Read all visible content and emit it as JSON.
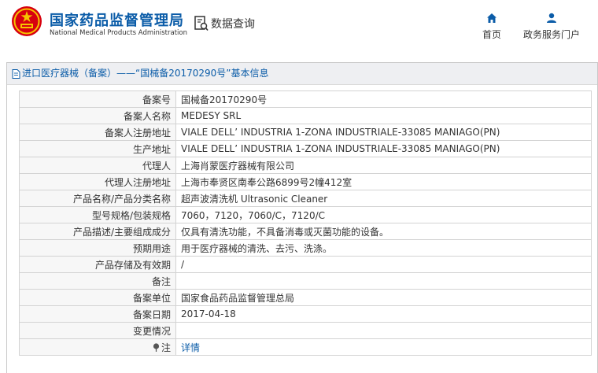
{
  "header": {
    "title": "国家药品监督管理局",
    "subtitle": "National Medical Products Administration",
    "query_label": "数据查询",
    "nav": [
      {
        "label": "首页",
        "icon": "home-icon"
      },
      {
        "label": "政务服务门户",
        "icon": "user-icon"
      }
    ]
  },
  "panel": {
    "title": "进口医疗器械（备案）——“国械备20170290号”基本信息"
  },
  "rows": [
    {
      "label": "备案号",
      "value": "国械备20170290号"
    },
    {
      "label": "备案人名称",
      "value": "MEDESY SRL"
    },
    {
      "label": "备案人注册地址",
      "value": "VIALE DELL’ INDUSTRIA 1-ZONA INDUSTRIALE-33085 MANIAGO(PN)"
    },
    {
      "label": "生产地址",
      "value": "VIALE DELL’ INDUSTRIA 1-ZONA INDUSTRIALE-33085 MANIAGO(PN)"
    },
    {
      "label": "代理人",
      "value": "上海肖蒙医疗器械有限公司"
    },
    {
      "label": "代理人注册地址",
      "value": "上海市奉贤区南奉公路6899号2幢412室"
    },
    {
      "label": "产品名称/产品分类名称",
      "value": "超声波清洗机 Ultrasonic Cleaner"
    },
    {
      "label": "型号规格/包装规格",
      "value": "7060，7120，7060/C，7120/C"
    },
    {
      "label": "产品描述/主要组成成分",
      "value": "仅具有清洗功能，不具备消毒或灭菌功能的设备。"
    },
    {
      "label": "预期用途",
      "value": "用于医疗器械的清洗、去污、洗涤。"
    },
    {
      "label": "产品存储及有效期",
      "value": "/"
    },
    {
      "label": "备注",
      "value": ""
    },
    {
      "label": "备案单位",
      "value": "国家食品药品监督管理总局"
    },
    {
      "label": "备案日期",
      "value": "2017-04-18"
    },
    {
      "label": "变更情况",
      "value": ""
    }
  ],
  "note_row": {
    "label": "注",
    "value": "详情"
  },
  "colors": {
    "brand_blue": "#0b5ca8",
    "emblem_red": "#d7000f",
    "emblem_gold": "#f5c400"
  }
}
